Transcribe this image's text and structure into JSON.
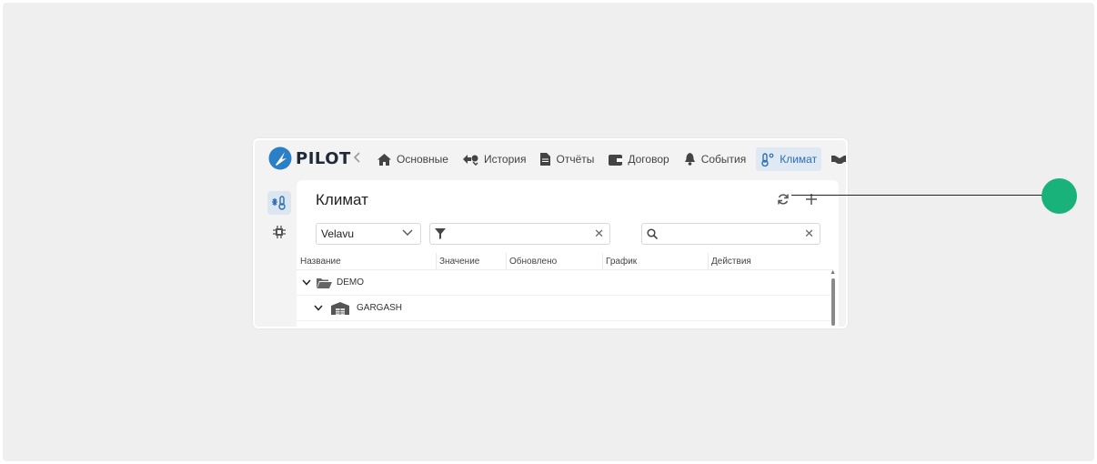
{
  "app": {
    "logo_text": "PILOT",
    "logo_icon": "pilot-logo-icon"
  },
  "nav": {
    "back_icon": "chevron-left-icon",
    "items": [
      {
        "label": "Основные",
        "icon": "home-icon"
      },
      {
        "label": "История",
        "icon": "history-icon"
      },
      {
        "label": "Отчёты",
        "icon": "report-icon"
      },
      {
        "label": "Договор",
        "icon": "wallet-icon"
      },
      {
        "label": "События",
        "icon": "bell-icon"
      },
      {
        "label": "Климат",
        "icon": "thermometer-icon",
        "active": true
      },
      {
        "label": "",
        "icon": "handshake-icon"
      }
    ]
  },
  "sidebar": {
    "items": [
      {
        "icon": "climate-icon",
        "active": true
      },
      {
        "icon": "chip-icon"
      }
    ]
  },
  "page": {
    "title": "Климат",
    "refresh_icon": "refresh-icon",
    "add_icon": "plus-icon"
  },
  "filters": {
    "select_value": "Velavu",
    "filter_value": "",
    "search_value": ""
  },
  "table": {
    "columns": [
      "Название",
      "Значение",
      "Обновлено",
      "График",
      "Действия"
    ],
    "rows": [
      {
        "label": "DEMO",
        "icon": "folder-open-icon",
        "level": 0
      },
      {
        "label": "GARGASH",
        "icon": "warehouse-icon",
        "level": 1
      }
    ]
  },
  "colors": {
    "accent": "#2b6fb0",
    "callout": "#18b27a"
  }
}
